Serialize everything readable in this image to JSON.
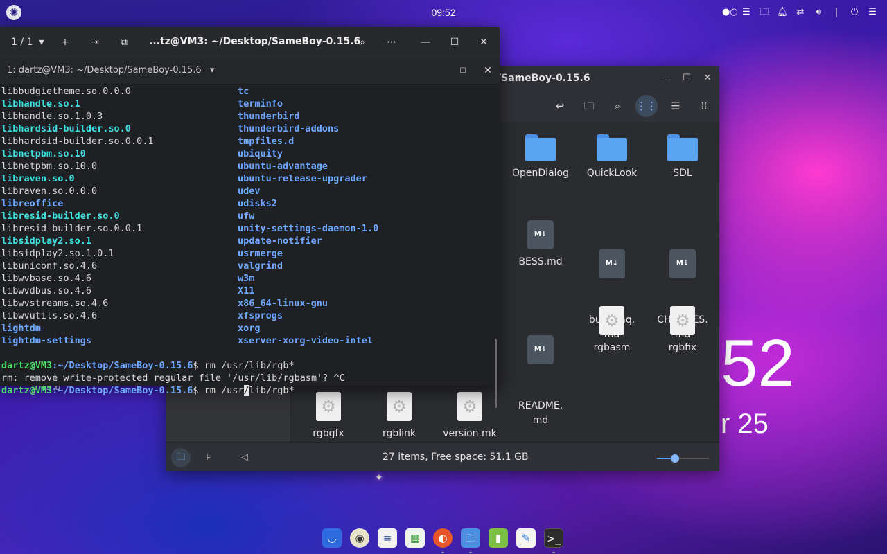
{
  "topbar": {
    "clock": "09:52",
    "tray_icons": [
      "indicator-icon",
      "screen-icon",
      "folder-icon",
      "bell-icon",
      "network-icon",
      "volume-icon",
      "power-icon",
      "menu-icon"
    ]
  },
  "desktop": {
    "time_fragment": "52",
    "date_fragment": "r 25",
    "folder_label_fragment": "0.15.6"
  },
  "file_manager": {
    "title": "/SameBoy-0.15.6",
    "items": [
      {
        "name": "OpenDialog",
        "type": "folder"
      },
      {
        "name": "QuickLook",
        "type": "folder"
      },
      {
        "name": "SDL",
        "type": "folder"
      },
      {
        "name": "BESS.md",
        "type": "markdown"
      },
      {
        "name": "build-faq.\nmd",
        "type": "markdown"
      },
      {
        "name": "CHANGES.\nmd",
        "type": "markdown"
      },
      {
        "name": "README.\nmd",
        "type": "markdown"
      },
      {
        "name": "rgbasm",
        "type": "executable"
      },
      {
        "name": "rgbfix",
        "type": "executable"
      },
      {
        "name": "rgbgfx",
        "type": "executable"
      },
      {
        "name": "rgblink",
        "type": "executable"
      },
      {
        "name": "version.mk",
        "type": "executable"
      }
    ],
    "status": "27 items, Free space: 51.1 GB",
    "zoom_level": 0.35
  },
  "terminal": {
    "tab_count": "1 / 1",
    "title": "...tz@VM3: ~/Desktop/SameBoy-0.15.6",
    "tab_label": "1: dartz@VM3: ~/Desktop/SameBoy-0.15.6",
    "listing": [
      {
        "left": "libbudgietheme.so.0.0.0",
        "left_style": "plain",
        "right": "tc",
        "right_style": "blue"
      },
      {
        "left": "libhandle.so.1",
        "left_style": "cyan",
        "right": "terminfo",
        "right_style": "blue"
      },
      {
        "left": "libhandle.so.1.0.3",
        "left_style": "plain",
        "right": "thunderbird",
        "right_style": "blue"
      },
      {
        "left": "libhardsid-builder.so.0",
        "left_style": "cyan",
        "right": "thunderbird-addons",
        "right_style": "blue"
      },
      {
        "left": "libhardsid-builder.so.0.0.1",
        "left_style": "plain",
        "right": "tmpfiles.d",
        "right_style": "blue"
      },
      {
        "left": "libnetpbm.so.10",
        "left_style": "cyan",
        "right": "ubiquity",
        "right_style": "blue"
      },
      {
        "left": "libnetpbm.so.10.0",
        "left_style": "plain",
        "right": "ubuntu-advantage",
        "right_style": "blue"
      },
      {
        "left": "libraven.so.0",
        "left_style": "cyan",
        "right": "ubuntu-release-upgrader",
        "right_style": "blue"
      },
      {
        "left": "libraven.so.0.0.0",
        "left_style": "plain",
        "right": "udev",
        "right_style": "blue"
      },
      {
        "left": "libreoffice",
        "left_style": "blue",
        "right": "udisks2",
        "right_style": "blue"
      },
      {
        "left": "libresid-builder.so.0",
        "left_style": "cyan",
        "right": "ufw",
        "right_style": "blue"
      },
      {
        "left": "libresid-builder.so.0.0.1",
        "left_style": "plain",
        "right": "unity-settings-daemon-1.0",
        "right_style": "blue"
      },
      {
        "left": "libsidplay2.so.1",
        "left_style": "cyan",
        "right": "update-notifier",
        "right_style": "blue"
      },
      {
        "left": "libsidplay2.so.1.0.1",
        "left_style": "plain",
        "right": "usrmerge",
        "right_style": "blue"
      },
      {
        "left": "libuniconf.so.4.6",
        "left_style": "plain",
        "right": "valgrind",
        "right_style": "blue"
      },
      {
        "left": "libwvbase.so.4.6",
        "left_style": "plain",
        "right": "w3m",
        "right_style": "blue"
      },
      {
        "left": "libwvdbus.so.4.6",
        "left_style": "plain",
        "right": "X11",
        "right_style": "blue"
      },
      {
        "left": "libwvstreams.so.4.6",
        "left_style": "plain",
        "right": "x86_64-linux-gnu",
        "right_style": "blue"
      },
      {
        "left": "libwvutils.so.4.6",
        "left_style": "plain",
        "right": "xfsprogs",
        "right_style": "blue"
      },
      {
        "left": "lightdm",
        "left_style": "blue",
        "right": "xorg",
        "right_style": "blue"
      },
      {
        "left": "lightdm-settings",
        "left_style": "blue",
        "right": "xserver-xorg-video-intel",
        "right_style": "blue"
      }
    ],
    "prompt_user": "dartz@VM3",
    "prompt_path": ":~/Desktop/SameBoy-0.15.6",
    "cmd1": "$ rm /usr/lib/rgb*",
    "message": "rm: remove write-protected regular file '/usr/lib/rgbasm'? ^C",
    "cmd2_before": "$ rm /usr",
    "cmd2_cursor": "/",
    "cmd2_after": "lib/rgb*"
  },
  "dock": {
    "items": [
      "store-icon",
      "speaker-icon",
      "text-editor-icon",
      "spreadsheet-icon",
      "firefox-icon",
      "files-icon",
      "android-icon",
      "document-editor-icon",
      "terminal-icon"
    ]
  }
}
